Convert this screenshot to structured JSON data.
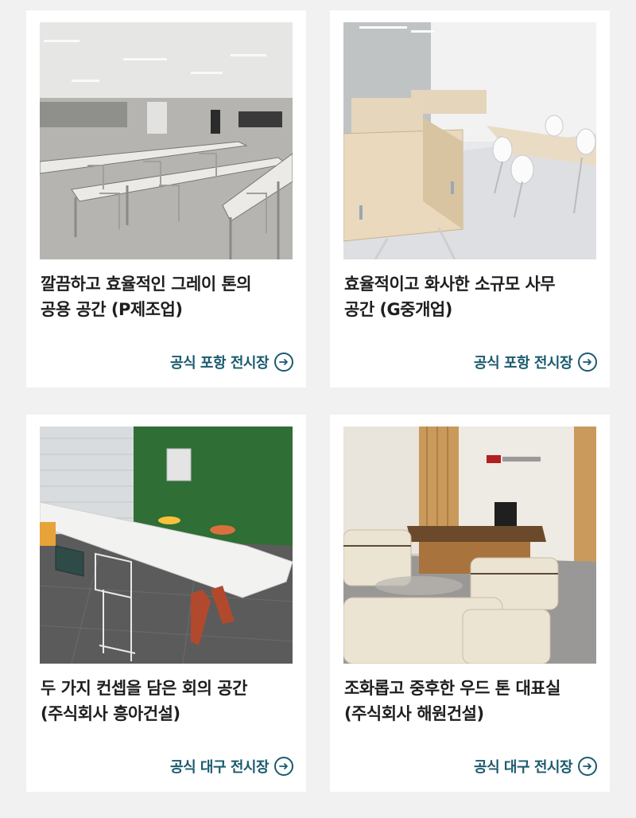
{
  "cards": [
    {
      "title_line1": "깔끔하고 효율적인 그레이 톤의",
      "title_line2": "공용 공간 (P제조업)",
      "link_label": "공식 포항 전시장",
      "photo": "grey-cafeteria-photo"
    },
    {
      "title_line1": "효율적이고 화사한 소규모 사무",
      "title_line2": "공간 (G중개업)",
      "link_label": "공식 포항 전시장",
      "photo": "wood-desk-office-photo"
    },
    {
      "title_line1": "두 가지 컨셉을 담은 회의 공간",
      "title_line2": "(주식회사 흥아건설)",
      "link_label": "공식 대구 전시장",
      "photo": "green-meeting-room-photo"
    },
    {
      "title_line1": "조화롭고 중후한 우드 톤 대표실",
      "title_line2": "(주식회사 해원건설)",
      "link_label": "공식 대구 전시장",
      "photo": "wood-executive-room-photo"
    }
  ],
  "colors": {
    "background": "#f1f1f1",
    "card": "#ffffff",
    "title": "#1e1e1e",
    "link": "#1a5a6e"
  },
  "icons": {
    "link_icon": "arrow-right-circle-icon"
  }
}
